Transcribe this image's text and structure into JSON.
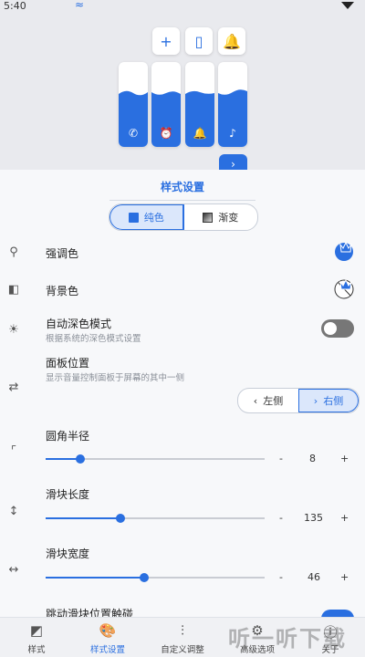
{
  "status_bar": {
    "time": "5:40"
  },
  "preview": {
    "buttons": [
      {
        "icon": "plus-icon",
        "glyph": "+"
      },
      {
        "icon": "remote-icon",
        "glyph": "▯"
      },
      {
        "icon": "bell-icon",
        "glyph": "🔔"
      }
    ],
    "sliders": [
      {
        "icon": "phone-icon",
        "glyph": "✆",
        "level": 0.6
      },
      {
        "icon": "alarm-icon",
        "glyph": "⏰",
        "level": 0.6
      },
      {
        "icon": "bell-icon",
        "glyph": "🔔",
        "level": 0.6
      },
      {
        "icon": "music-icon",
        "glyph": "♪",
        "level": 0.6
      }
    ],
    "expand_glyph": "›",
    "accent_color": "#2a6fe0"
  },
  "sheet": {
    "title": "样式设置",
    "style_tabs": [
      {
        "label": "纯色",
        "active": true
      },
      {
        "label": "渐变",
        "active": false
      }
    ],
    "accent_color": {
      "label": "强调色"
    },
    "background_color": {
      "label": "背景色"
    },
    "auto_dark": {
      "label": "自动深色模式",
      "sub": "根据系统的深色模式设置",
      "enabled": false
    },
    "panel_position": {
      "label": "面板位置",
      "sub": "显示音量控制面板于屏幕的其中一侧",
      "left_label": "左侧",
      "right_label": "右侧",
      "selected": "右侧"
    },
    "corner_radius": {
      "label": "圆角半径",
      "value": "8",
      "fraction": 0.16,
      "minus": "-",
      "plus": "+"
    },
    "slider_length": {
      "label": "滑块长度",
      "value": "135",
      "fraction": 0.34,
      "minus": "-",
      "plus": "+"
    },
    "slider_width": {
      "label": "滑块宽度",
      "value": "46",
      "fraction": 0.45,
      "minus": "-",
      "plus": "+"
    },
    "haptic": {
      "label": "跳动滑块位置触碰"
    }
  },
  "bottom_nav": [
    {
      "label": "样式",
      "icon": "style-icon",
      "glyph": "◩",
      "active": false
    },
    {
      "label": "样式设置",
      "icon": "palette-icon",
      "glyph": "🎨",
      "active": true
    },
    {
      "label": "自定义调整",
      "icon": "tune-icon",
      "glyph": "⫶",
      "active": false
    },
    {
      "label": "高级选项",
      "icon": "gear-icon",
      "glyph": "⚙",
      "active": false
    },
    {
      "label": "关于",
      "icon": "info-icon",
      "glyph": "ⓘ",
      "active": false
    }
  ],
  "watermark": "听一听下载"
}
